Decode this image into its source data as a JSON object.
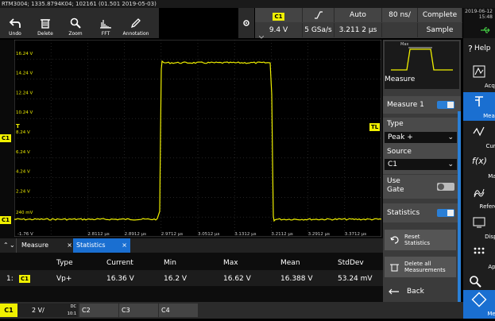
{
  "title_bar": "RTM3004; 1335.8794K04; 102161 (01.501 2019-05-03)",
  "toolbar": [
    {
      "label": "Undo",
      "icon": "undo-icon"
    },
    {
      "label": "Delete",
      "icon": "trash-icon"
    },
    {
      "label": "Zoom",
      "icon": "zoom-icon"
    },
    {
      "label": "FFT",
      "icon": "fft-icon"
    },
    {
      "label": "Annotation",
      "icon": "pen-icon"
    }
  ],
  "acquisition": {
    "channel": "C1",
    "trigger_level": "9.4 V",
    "trigger_mode": "Auto",
    "sample_rate": "5 GSa/s",
    "timebase": "80 ns/",
    "record_length": "3.211 2 μs",
    "acq_status": "Complete",
    "acq_mode": "Sample"
  },
  "datetime": {
    "date": "2019-06-12",
    "time": "15:48"
  },
  "scope": {
    "y_labels": [
      "16.24 V",
      "14.24 V",
      "12.24 V",
      "10.24 V",
      "8.24 V",
      "6.24 V",
      "4.24 V",
      "2.24 V",
      "240 mV"
    ],
    "x_labels": [
      "-1.76 V",
      "2.8112 μs",
      "2.8912 μs",
      "2.9712 μs",
      "3.0512 μs",
      "3.1312 μs",
      "3.2112 μs",
      "3.2912 μs",
      "3.3712 μs"
    ],
    "trigger_marker_left": "T",
    "trigger_marker_right": "TL",
    "ch_marker": "C1",
    "ch_marker_bottom": "C1"
  },
  "measure_panel": {
    "preview_label": "Max",
    "title": "Measure",
    "measure1_label": "Measure 1",
    "type_label": "Type",
    "type_value": "Peak +",
    "source_label": "Source",
    "source_value": "C1",
    "use_gate_label": "Use Gate",
    "statistics_label": "Statistics",
    "reset_stats_label": "Reset Statistics",
    "delete_all_label": "Delete all Measurements",
    "back_label": "Back"
  },
  "side_menu": [
    {
      "label": "Help",
      "icon": "help-icon"
    },
    {
      "label": "Acquire",
      "icon": "acquire-icon"
    },
    {
      "label": "Measure",
      "icon": "measure-icon"
    },
    {
      "label": "Cursor",
      "icon": "cursor-icon"
    },
    {
      "label": "Math",
      "icon": "math-icon"
    },
    {
      "label": "References",
      "icon": "references-icon"
    },
    {
      "label": "Display",
      "icon": "display-icon"
    },
    {
      "label": "Apps",
      "icon": "apps-icon"
    },
    {
      "label": "Menu",
      "icon": "menu-icon"
    }
  ],
  "tabs": [
    {
      "label": "Measure"
    },
    {
      "label": "Statistics"
    }
  ],
  "stats_table": {
    "headers": [
      "Type",
      "Current",
      "Min",
      "Max",
      "Mean",
      "StdDev"
    ],
    "row": {
      "index": "1:",
      "channel": "C1",
      "type": "Vp+",
      "current": "16.36 V",
      "min": "16.2 V",
      "max": "16.62 V",
      "mean": "16.388 V",
      "stddev": "53.24 mV"
    }
  },
  "channel_bar": {
    "c1_label": "C1",
    "c1_scale": "2 V/",
    "c1_coupling": "DC",
    "c1_bw": "10:1",
    "c2_label": "C2",
    "c3_label": "C3",
    "c4_label": "C4"
  },
  "colors": {
    "channel1": "#f0f000",
    "accent": "#1a6fd1"
  }
}
